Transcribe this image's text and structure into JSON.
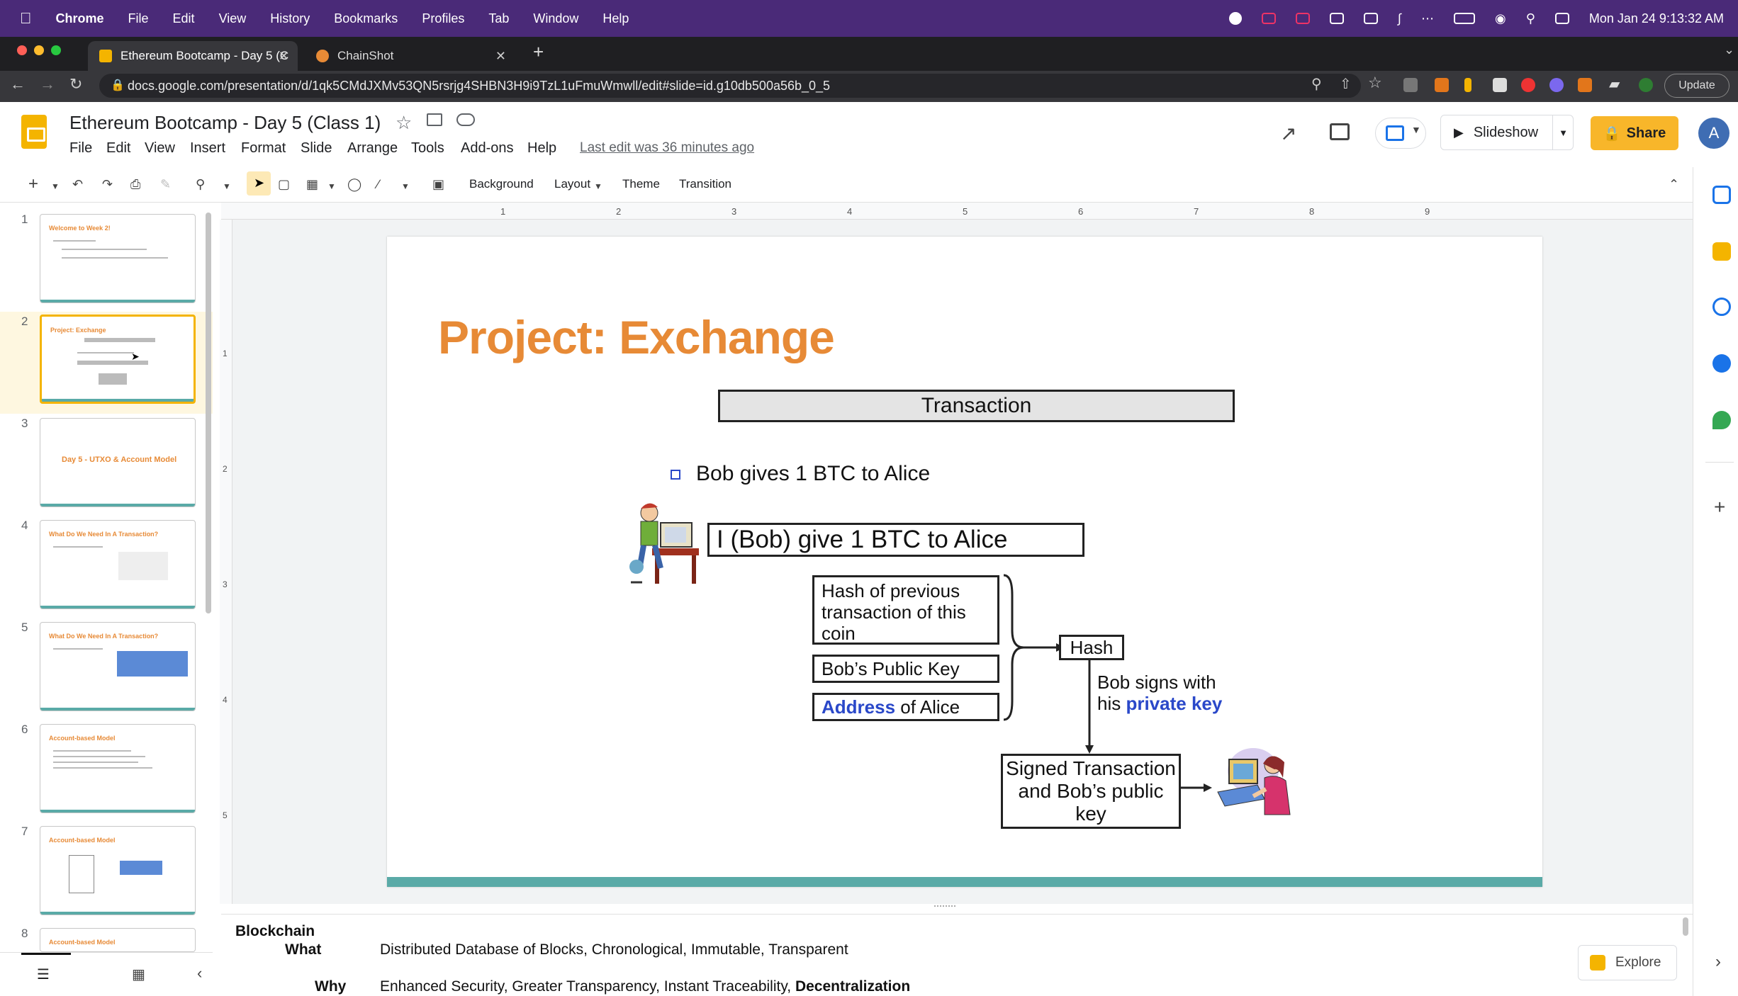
{
  "mac_menubar": {
    "app": "Chrome",
    "items": [
      "File",
      "Edit",
      "View",
      "History",
      "Bookmarks",
      "Profiles",
      "Tab",
      "Window",
      "Help"
    ],
    "clock": "Mon Jan 24  9:13:32 AM"
  },
  "browser": {
    "tabs": [
      {
        "title": "Ethereum Bootcamp - Day 5 (C",
        "active": true
      },
      {
        "title": "ChainShot",
        "active": false
      }
    ],
    "url": "docs.google.com/presentation/d/1qk5CMdJXMv53QN5rsrjg4SHBN3H9i9TzL1uFmuWmwll/edit#slide=id.g10db500a56b_0_5",
    "update_label": "Update"
  },
  "docs": {
    "title": "Ethereum Bootcamp - Day 5 (Class 1)",
    "menu": [
      "File",
      "Edit",
      "View",
      "Insert",
      "Format",
      "Slide",
      "Arrange",
      "Tools",
      "Add-ons",
      "Help"
    ],
    "last_edit": "Last edit was 36 minutes ago",
    "slideshow_label": "Slideshow",
    "share_label": "Share",
    "avatar_letter": "A"
  },
  "toolbar": {
    "background": "Background",
    "layout": "Layout",
    "theme": "Theme",
    "transition": "Transition"
  },
  "filmstrip": [
    {
      "num": "1",
      "title": "Welcome to Week 2!"
    },
    {
      "num": "2",
      "title": "Project: Exchange"
    },
    {
      "num": "3",
      "title": "Day 5 - UTXO & Account Model"
    },
    {
      "num": "4",
      "title": "What Do We Need In A Transaction?"
    },
    {
      "num": "5",
      "title": "What Do We Need In A Transaction?"
    },
    {
      "num": "6",
      "title": "Account-based Model"
    },
    {
      "num": "7",
      "title": "Account-based Model"
    },
    {
      "num": "8",
      "title": "Account-based Model"
    }
  ],
  "ruler": {
    "h": [
      "1",
      "2",
      "3",
      "4",
      "5",
      "6",
      "7",
      "8",
      "9"
    ],
    "v": [
      "1",
      "2",
      "3",
      "4",
      "5"
    ]
  },
  "slide": {
    "title": "Project: Exchange",
    "transaction": "Transaction",
    "bullet": "Bob gives 1 BTC to Alice",
    "bob_box": "I (Bob) give 1 BTC to Alice",
    "hash_prev": "Hash of previous transaction of this coin",
    "public_key": "Bob’s Public Key",
    "address_word": "Address",
    "address_rest": " of Alice",
    "hash": "Hash",
    "signs_line1": "Bob signs with",
    "signs_line2a": "his ",
    "signs_line2b": "private key",
    "signed": "Signed Transaction and Bob’s public key"
  },
  "notes": {
    "heading": "Blockchain",
    "what_label": "What",
    "what_text": "Distributed Database of Blocks, Chronological, Immutable, Transparent",
    "why_label": "Why",
    "why_text": "Enhanced Security, Greater Transparency, Instant Traceability, ",
    "why_bold": "Decentralization"
  },
  "explore_label": "Explore",
  "colors": {
    "accent": "#e78a36",
    "teal": "#5aaaa7",
    "blue": "#2a48c9",
    "share": "#f8b62a"
  }
}
